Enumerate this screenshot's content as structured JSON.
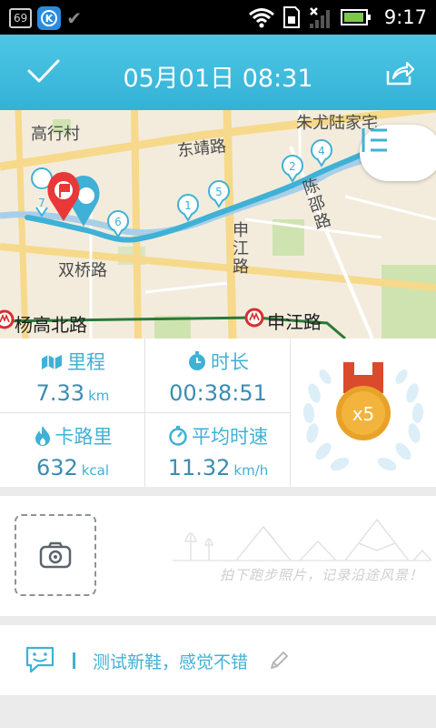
{
  "status_bar": {
    "badge": "69",
    "k_letter": "K",
    "time": "9:17"
  },
  "header": {
    "title": "05月01日 08:31"
  },
  "map": {
    "places": {
      "gaoxing": "高行村",
      "zhuyou": "朱尤陆家宅",
      "dongjing": "东靖路",
      "chenshao": "陈邵路",
      "shenjiang_road": "申江路",
      "shuangqiao": "双桥路"
    },
    "metro": {
      "yanggao": "杨高北路",
      "shenjiang": "申江路"
    },
    "markers": [
      "1",
      "2",
      "4",
      "5",
      "6",
      "7"
    ],
    "route_color": "#3fb1d6"
  },
  "stats": {
    "distance": {
      "label": "里程",
      "value": "7.33",
      "unit": "km"
    },
    "duration": {
      "label": "时长",
      "value": "00:38:51"
    },
    "calories": {
      "label": "卡路里",
      "value": "632",
      "unit": "kcal"
    },
    "avg_speed": {
      "label": "平均时速",
      "value": "11.32",
      "unit": "km/h"
    },
    "medal": {
      "text": "x5"
    }
  },
  "photo": {
    "hint": "拍下跑步照片，记录沿途风景！"
  },
  "note": {
    "text": "测试新鞋，感觉不错"
  },
  "colors": {
    "accent": "#3fb1d6",
    "header": "#33b2d6",
    "medal": "#e8a22a"
  }
}
